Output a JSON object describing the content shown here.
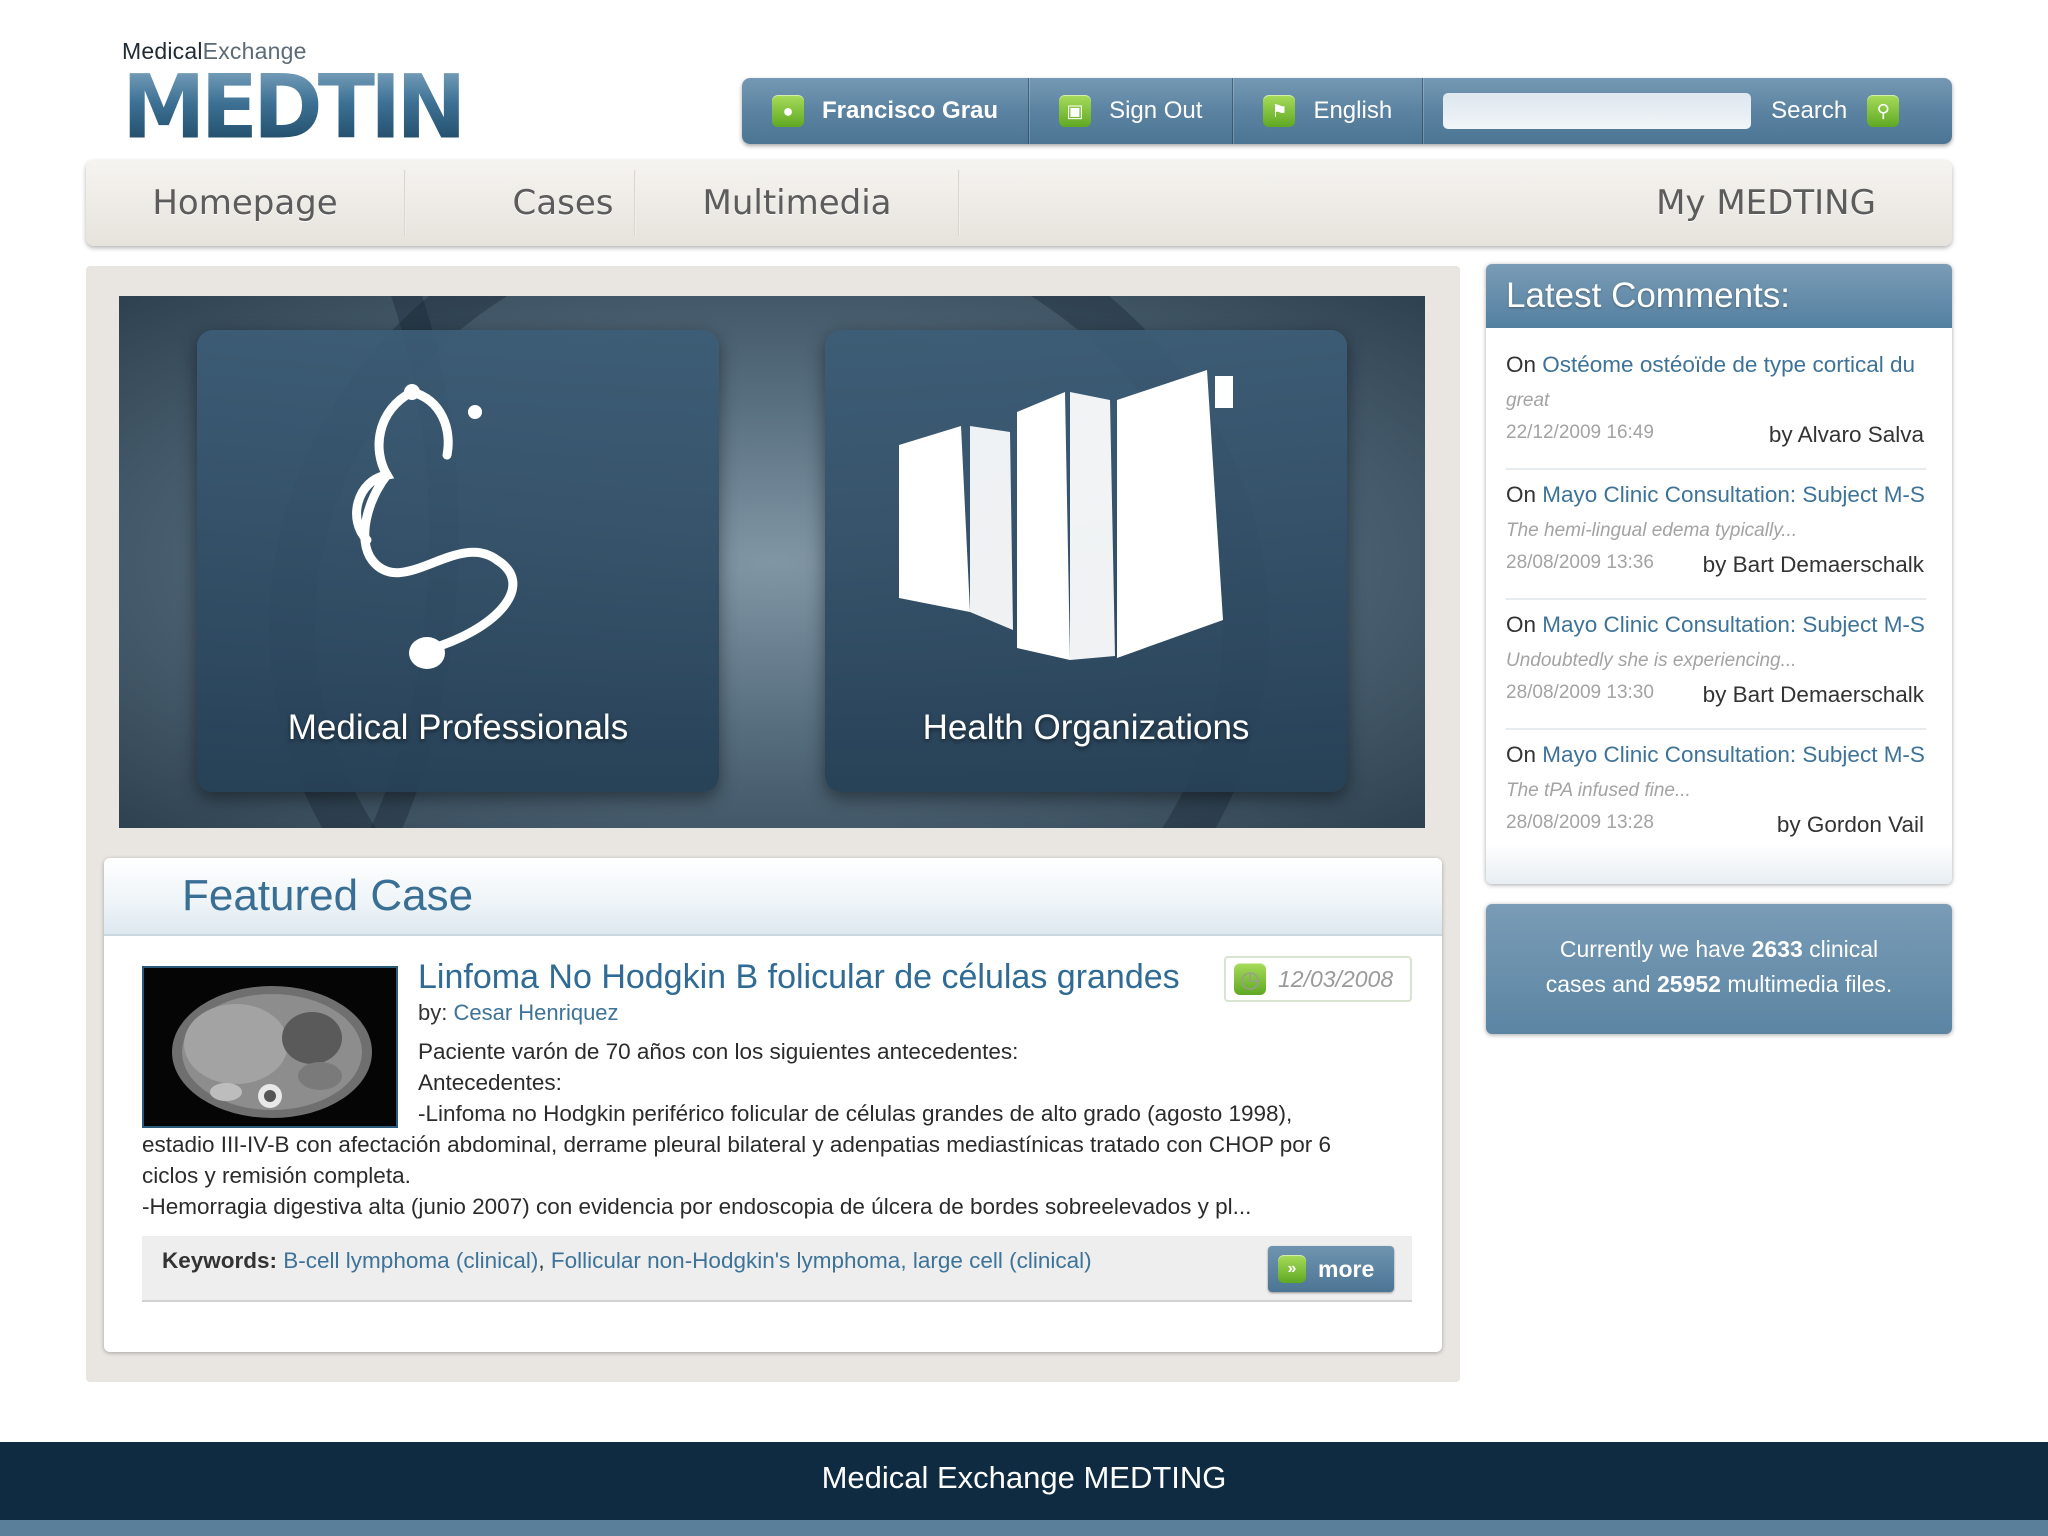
{
  "logo": {
    "sup_a": "Medical",
    "sup_b": "Exchange",
    "main": "MEDTING"
  },
  "userbar": {
    "user": "Francisco Grau",
    "sign_out": "Sign Out",
    "language": "English",
    "search_placeholder": "",
    "search_label": "Search"
  },
  "nav": {
    "homepage": "Homepage",
    "cases": "Cases",
    "multimedia": "Multimedia",
    "my": "My MEDTING"
  },
  "hero": {
    "left_label": "Medical Professionals",
    "right_label": "Health Organizations"
  },
  "featured": {
    "heading": "Featured Case",
    "title": "Linfoma No Hodgkin B folicular de células grandes",
    "date": "12/03/2008",
    "by_label": "by: ",
    "author": "Cesar Henriquez",
    "line1": "Paciente varón de 70 años con los siguientes antecedentes:",
    "line2": "Antecedentes:",
    "line3": "-Linfoma no Hodgkin periférico folicular de células grandes de alto grado (agosto 1998),",
    "line4": "estadio III-IV-B con afectación abdominal, derrame pleural bilateral y adenpatias mediastínicas tratado con CHOP por 6",
    "line5": "ciclos y remisión completa.",
    "line6": "-Hemorragia digestiva alta (junio 2007) con evidencia por endoscopia de úlcera de bordes sobreelevados y pl...",
    "keywords_label": "Keywords:",
    "keyword1": "B-cell lymphoma (clinical)",
    "keyword_sep": ", ",
    "keyword2": "Follicular non-Hodgkin's lymphoma, large cell (clinical)",
    "more": "more"
  },
  "comments": {
    "title": "Latest Comments:",
    "on": "On ",
    "items": [
      {
        "case": "Ostéome ostéoïde de type cortical du",
        "excerpt": "great",
        "date": "22/12/2009 16:49",
        "author": "by Alvaro Salva"
      },
      {
        "case": "Mayo Clinic Consultation: Subject M-S",
        "excerpt": "The hemi-lingual edema typically...",
        "date": "28/08/2009 13:36",
        "author": "by Bart Demaerschalk"
      },
      {
        "case": "Mayo Clinic Consultation: Subject M-S",
        "excerpt": "Undoubtedly she is experiencing...",
        "date": "28/08/2009 13:30",
        "author": "by Bart Demaerschalk"
      },
      {
        "case": "Mayo Clinic Consultation: Subject M-S",
        "excerpt": "The tPA infused fine...",
        "date": "28/08/2009 13:28",
        "author": "by Gordon Vail"
      }
    ]
  },
  "stats": {
    "t1": "Currently we have ",
    "cases": "2633",
    "t2": " clinical",
    "t3": "cases and ",
    "files": "25952",
    "t4": " multimedia files."
  },
  "footer": {
    "text": "Medical Exchange MEDTING"
  },
  "colors": {
    "accent": "#4c7594",
    "link": "#3d7399",
    "footer": "#0f2b41",
    "icon_green": "#6ab22d"
  }
}
